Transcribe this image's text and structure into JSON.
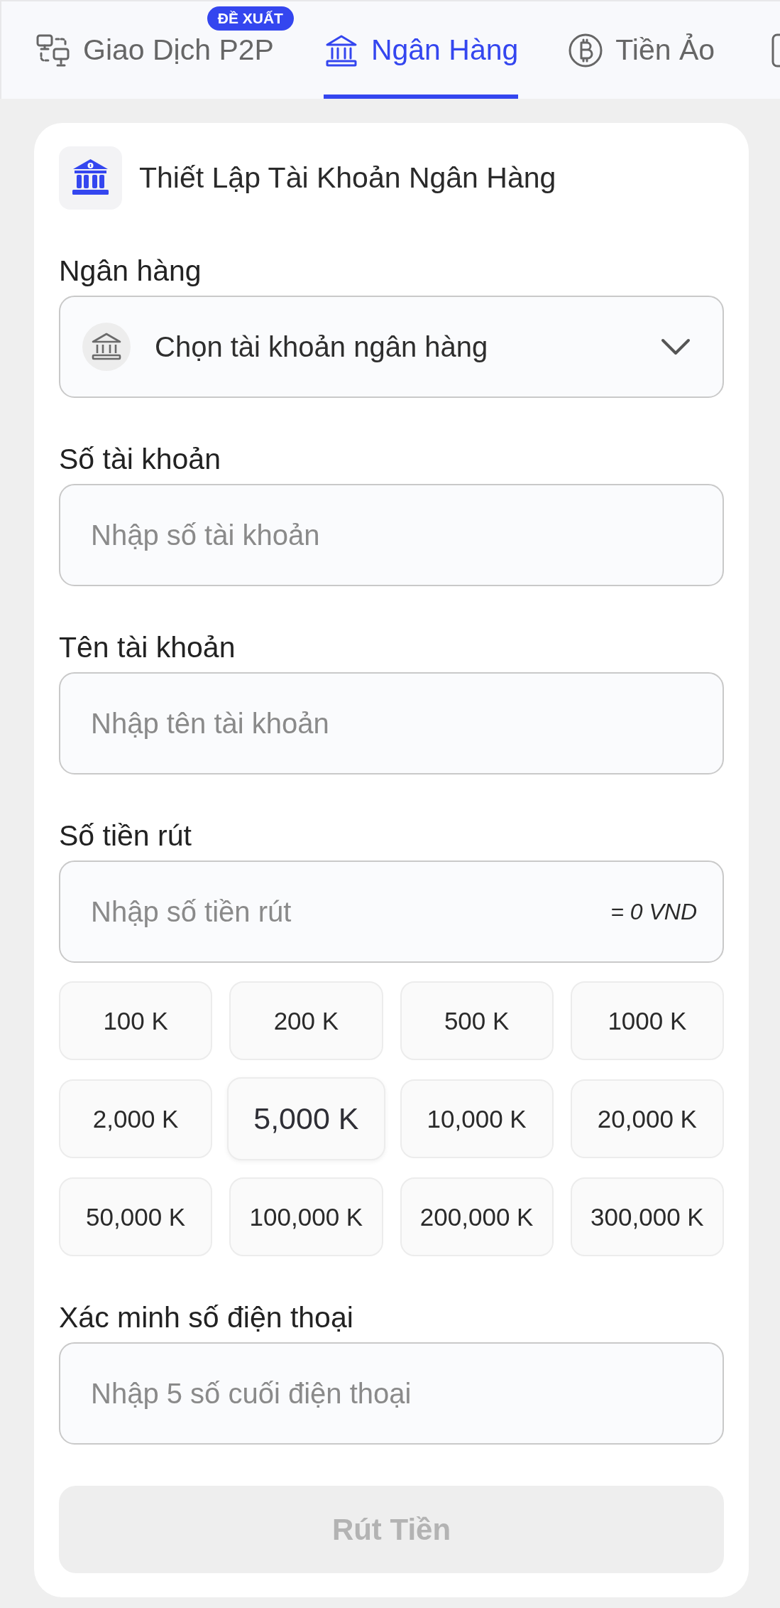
{
  "tabs": [
    {
      "kind": "p2p",
      "label": "Giao Dịch P2P",
      "badge": "ĐỀ XUẤT",
      "selected": false
    },
    {
      "kind": "bank",
      "label": "Ngân Hàng",
      "selected": true
    },
    {
      "kind": "coin",
      "label": "Tiền Ảo",
      "selected": false
    },
    {
      "kind": "cut",
      "selected": false
    }
  ],
  "header": {
    "title": "Thiết Lập Tài Khoản Ngân Hàng"
  },
  "fields": [
    {
      "kind": "select",
      "label": "Ngân hàng",
      "placeholder": "Chọn tài khoản ngân hàng"
    },
    {
      "kind": "text",
      "label": "Số tài khoản",
      "placeholder": "Nhập số tài khoản"
    },
    {
      "kind": "text",
      "label": "Tên tài khoản",
      "placeholder": "Nhập tên tài khoản"
    },
    {
      "kind": "amount",
      "label": "Số tiền rút",
      "placeholder": "Nhập số tiền rút",
      "converted": "= 0 VND",
      "presets": [
        {
          "label": "100 K",
          "hovered": false
        },
        {
          "label": "200 K",
          "hovered": false
        },
        {
          "label": "500 K",
          "hovered": false
        },
        {
          "label": "1000 K",
          "hovered": false
        },
        {
          "label": "2,000 K",
          "hovered": false
        },
        {
          "label": "5,000 K",
          "hovered": true
        },
        {
          "label": "10,000 K",
          "hovered": false
        },
        {
          "label": "20,000 K",
          "hovered": false
        },
        {
          "label": "50,000 K",
          "hovered": false
        },
        {
          "label": "100,000 K",
          "hovered": false
        },
        {
          "label": "200,000 K",
          "hovered": false
        },
        {
          "label": "300,000 K",
          "hovered": false
        }
      ]
    },
    {
      "kind": "text",
      "label": "Xác minh số điện thoại",
      "placeholder": "Nhập 5 số cuối điện thoại"
    }
  ],
  "submit": {
    "label": "Rút Tiền",
    "disabled": true
  }
}
